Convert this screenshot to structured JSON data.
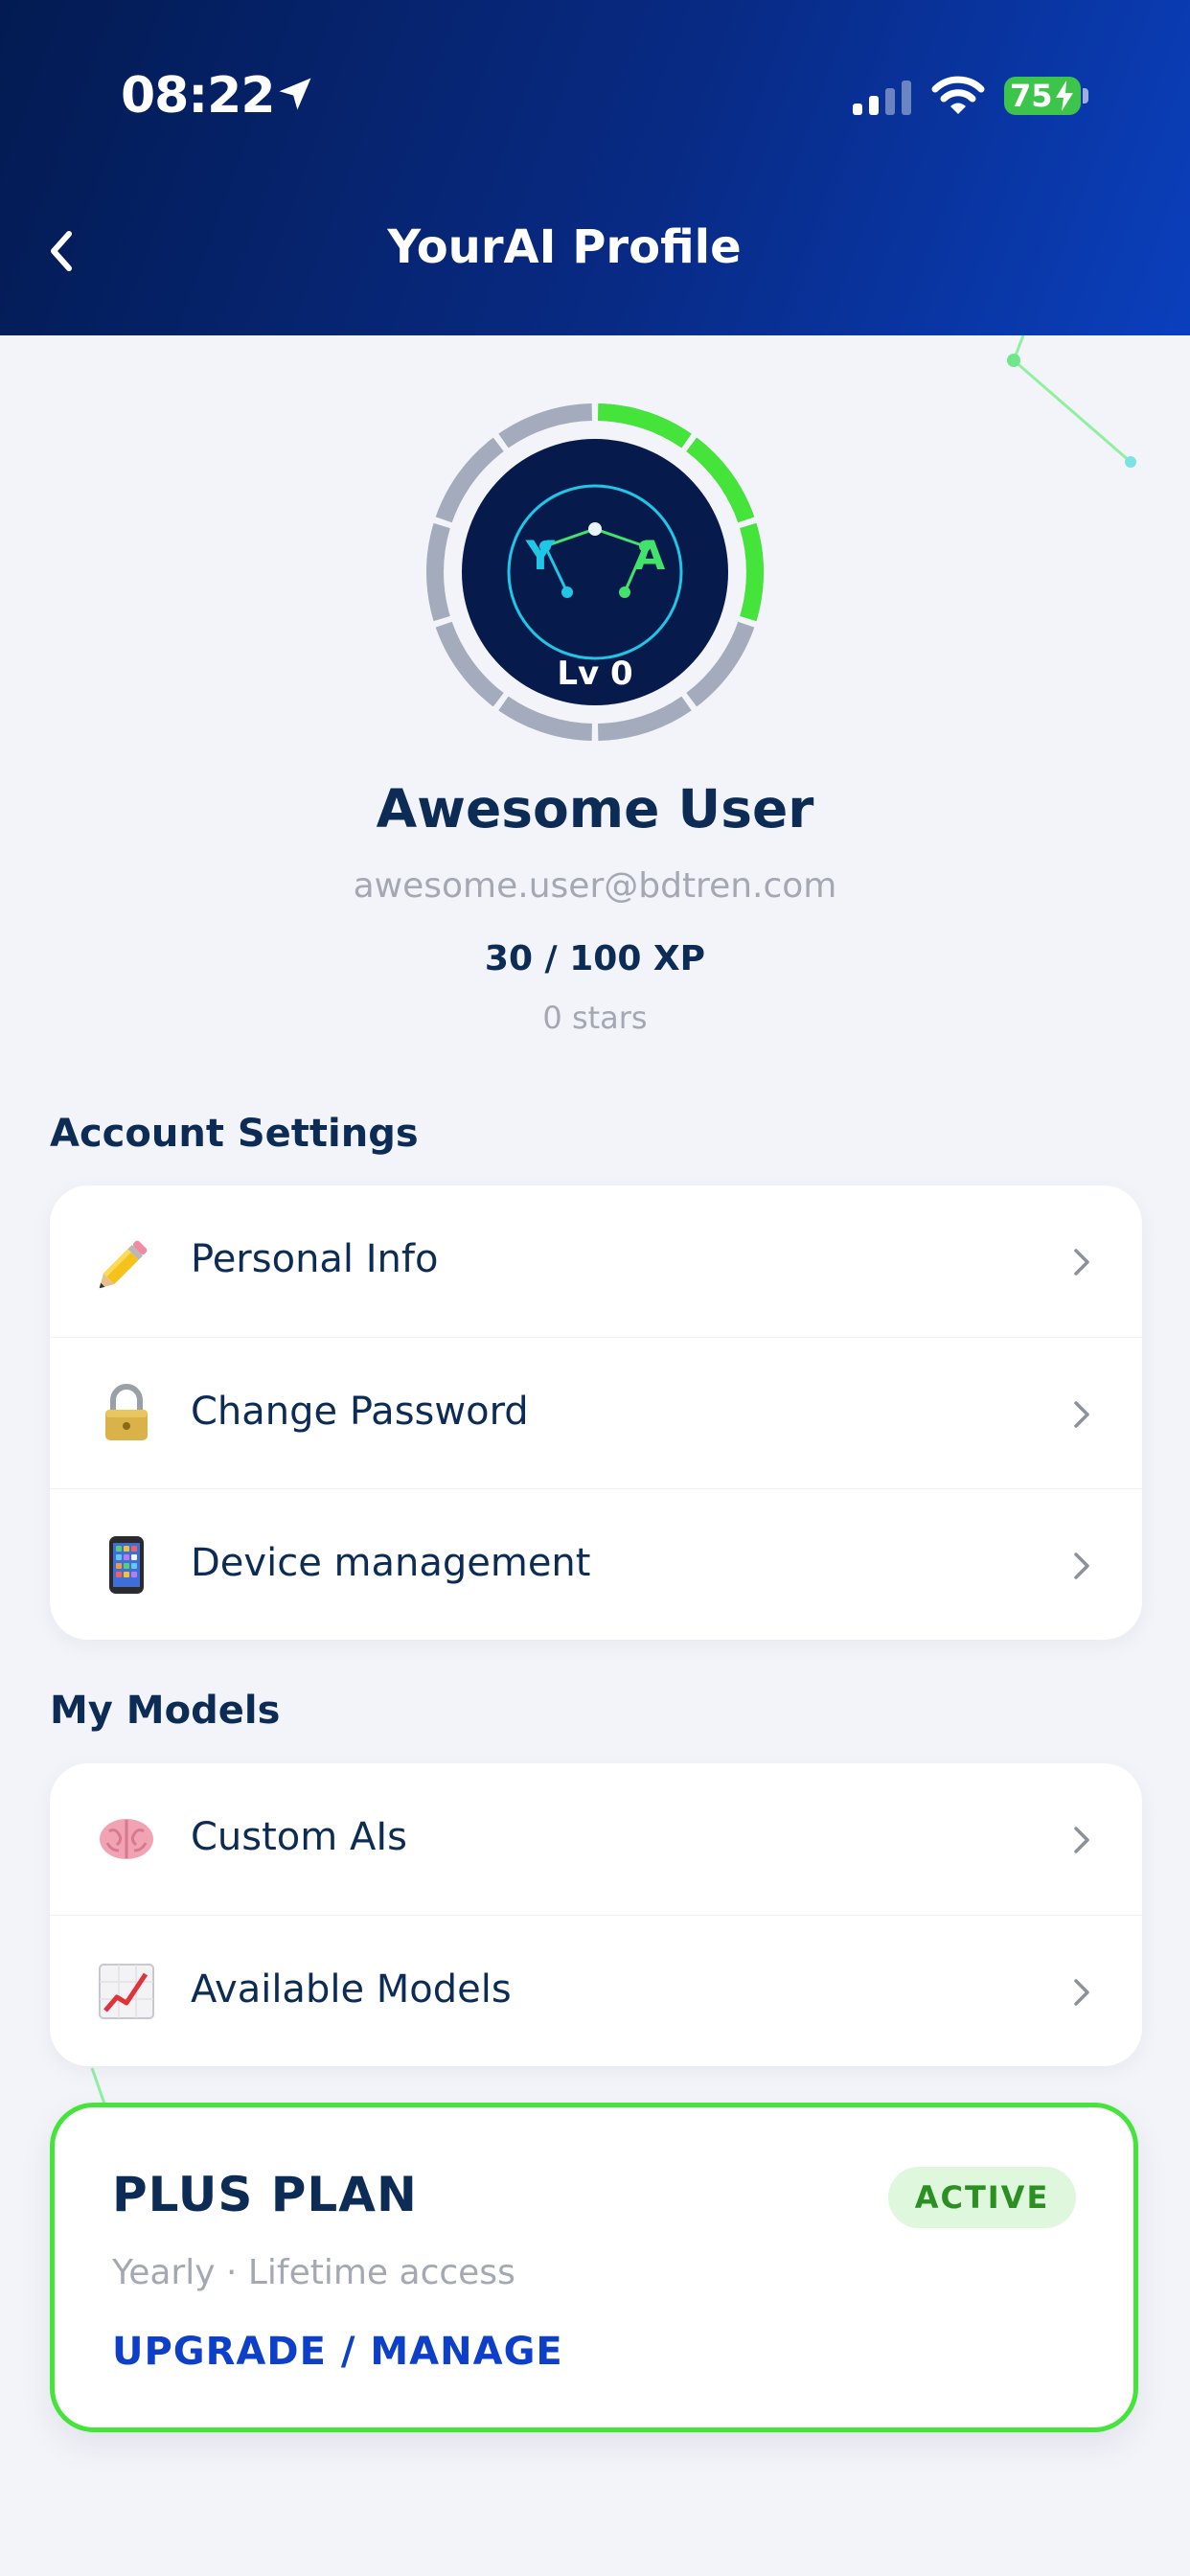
{
  "status_bar": {
    "time": "08:22",
    "battery": "75"
  },
  "header": {
    "title": "YourAI Profile",
    "back_icon": "chevron-left-icon"
  },
  "profile": {
    "level_label": "Lv 0",
    "level_progress": 0.3,
    "avatar_letters": [
      "Y",
      "A"
    ],
    "name": "Awesome User",
    "email": "awesome.user@bdtren.com",
    "xp": "30 / 100 XP",
    "stars": "0 stars"
  },
  "account_settings": {
    "heading": "Account Settings",
    "items": [
      {
        "label": "Personal Info",
        "icon": "pencil-icon"
      },
      {
        "label": "Change Password",
        "icon": "lock-icon"
      },
      {
        "label": "Device management",
        "icon": "mobile-phone-icon"
      }
    ]
  },
  "my_models": {
    "heading": "My Models",
    "items": [
      {
        "label": "Custom AIs",
        "icon": "brain-icon"
      },
      {
        "label": "Available Models",
        "icon": "chart-increasing-icon"
      }
    ]
  },
  "plan": {
    "title": "PLUS PLAN",
    "status": "ACTIVE",
    "subtitle": "Yearly · Lifetime access",
    "action": "UPGRADE / MANAGE"
  },
  "colors": {
    "header_start": "#031b52",
    "header_end": "#0a3fbc",
    "accent_green": "#44e43a",
    "title_navy": "#0c2b55",
    "link_blue": "#0e3fc8",
    "muted_gray": "#a4a8b3"
  }
}
